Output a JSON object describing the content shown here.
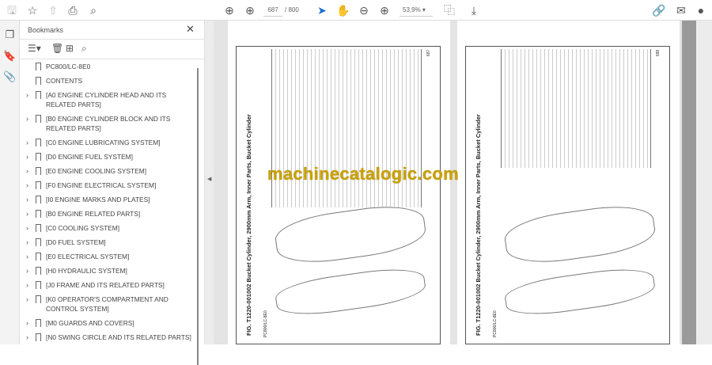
{
  "toolbar": {
    "page_current": "687",
    "page_total": "/ 800",
    "zoom": "53,9%"
  },
  "bookmarks": {
    "title": "Bookmarks",
    "items": [
      {
        "label": "PC800/LC-8E0",
        "expandable": false
      },
      {
        "label": "CONTENTS",
        "expandable": false
      },
      {
        "label": "[A0 ENGINE CYLINDER HEAD AND ITS RELATED PARTS]",
        "expandable": true
      },
      {
        "label": "[B0 ENGINE CYLINDER BLOCK AND ITS RELATED PARTS]",
        "expandable": true
      },
      {
        "label": "[C0 ENGINE LUBRICATING SYSTEM]",
        "expandable": true
      },
      {
        "label": "[D0 ENGINE FUEL SYSTEM]",
        "expandable": true
      },
      {
        "label": "[E0 ENGINE COOLING SYSTEM]",
        "expandable": true
      },
      {
        "label": "[F0 ENGINE ELECTRICAL SYSTEM]",
        "expandable": true
      },
      {
        "label": "[I0 ENGINE MARKS AND PLATES]",
        "expandable": true
      },
      {
        "label": "[B0 ENGINE RELATED PARTS]",
        "expandable": true
      },
      {
        "label": "[C0 COOLING SYSTEM]",
        "expandable": true
      },
      {
        "label": "[D0 FUEL SYSTEM]",
        "expandable": true
      },
      {
        "label": "[E0 ELECTRICAL SYSTEM]",
        "expandable": true
      },
      {
        "label": "[H0 HYDRAULIC SYSTEM]",
        "expandable": true
      },
      {
        "label": "[J0 FRAME AND ITS RELATED PARTS]",
        "expandable": true
      },
      {
        "label": "[K0 OPERATOR'S COMPARTMENT AND CONTROL SYSTEM]",
        "expandable": true
      },
      {
        "label": "[M0 GUARDS AND COVERS]",
        "expandable": true
      },
      {
        "label": "[N0 SWING CIRCLE AND ITS RELATED PARTS]",
        "expandable": true
      }
    ]
  },
  "pages": [
    {
      "title": "FIG. T1220-001002   Bucket Cylinder, 2900mm Arm, Inner Parts, Bucket Cylinder",
      "number": "687",
      "footer": "PC800/LC-8E0"
    },
    {
      "title": "FIG. T1220-001002   Bucket Cylinder, 2900mm Arm, Inner Parts, Bucket Cylinder",
      "number": "688",
      "footer": "PC800/LC-8E0"
    }
  ],
  "watermark": "machinecatalogic.com"
}
